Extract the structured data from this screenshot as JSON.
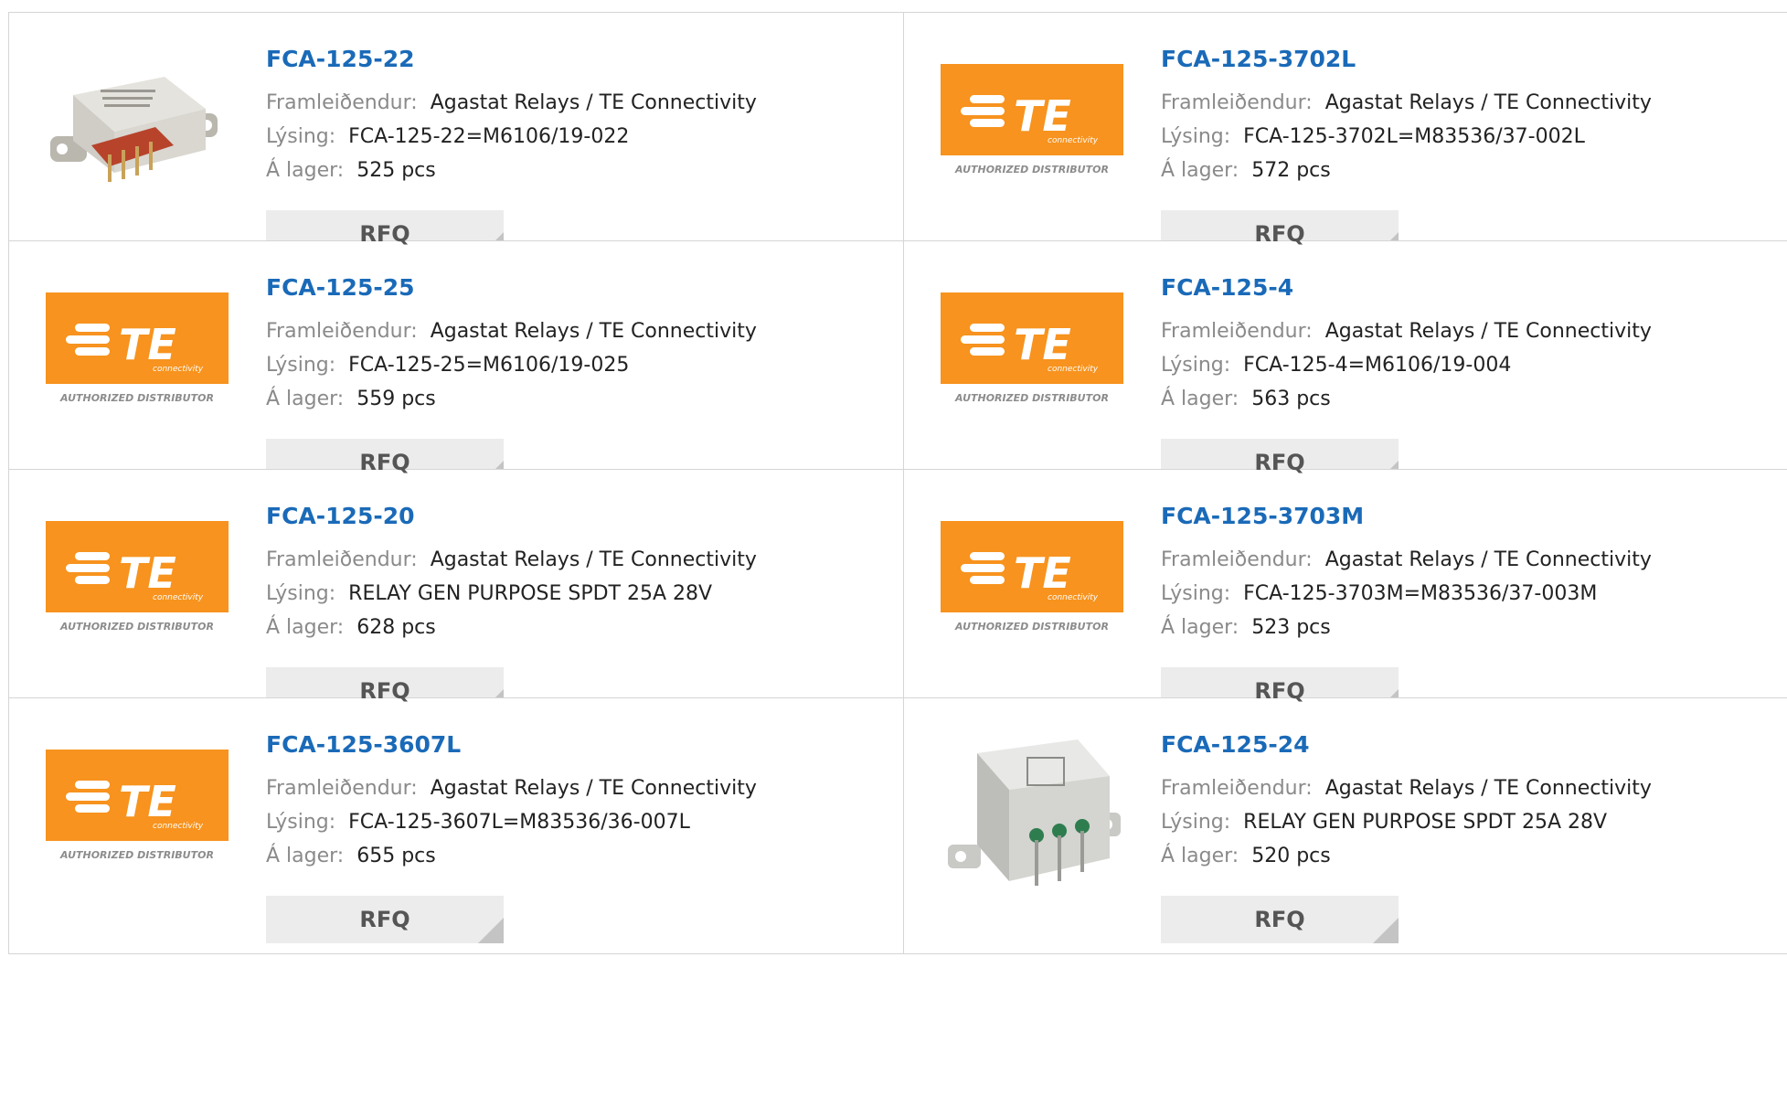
{
  "labels": {
    "manufacturer": "Framleiðendur:",
    "description": "Lýsing:",
    "stock": "Á lager:",
    "rfq": "RFQ"
  },
  "logo": {
    "brand": "TE",
    "tagline": "connectivity",
    "badge": "AUTHORIZED DISTRIBUTOR",
    "color": "#f7931e"
  },
  "colors": {
    "part_link": "#1a6ab8",
    "label": "#8a8a8a",
    "value": "#222222",
    "border": "#d5d5d5",
    "rfq_bg": "#ececec"
  },
  "products": [
    {
      "part": "FCA-125-22",
      "manufacturer": "Agastat Relays / TE Connectivity",
      "description": "FCA-125-22=M6106/19-022",
      "stock": "525 pcs",
      "image": "relay-photo-red-base"
    },
    {
      "part": "FCA-125-3702L",
      "manufacturer": "Agastat Relays / TE Connectivity",
      "description": "FCA-125-3702L=M83536/37-002L",
      "stock": "572 pcs",
      "image": "te-logo"
    },
    {
      "part": "FCA-125-25",
      "manufacturer": "Agastat Relays / TE Connectivity",
      "description": "FCA-125-25=M6106/19-025",
      "stock": "559 pcs",
      "image": "te-logo"
    },
    {
      "part": "FCA-125-4",
      "manufacturer": "Agastat Relays / TE Connectivity",
      "description": "FCA-125-4=M6106/19-004",
      "stock": "563 pcs",
      "image": "te-logo"
    },
    {
      "part": "FCA-125-20",
      "manufacturer": "Agastat Relays / TE Connectivity",
      "description": "RELAY GEN PURPOSE SPDT 25A 28V",
      "stock": "628 pcs",
      "image": "te-logo"
    },
    {
      "part": "FCA-125-3703M",
      "manufacturer": "Agastat Relays / TE Connectivity",
      "description": "FCA-125-3703M=M83536/37-003M",
      "stock": "523 pcs",
      "image": "te-logo"
    },
    {
      "part": "FCA-125-3607L",
      "manufacturer": "Agastat Relays / TE Connectivity",
      "description": "FCA-125-3607L=M83536/36-007L",
      "stock": "655 pcs",
      "image": "te-logo"
    },
    {
      "part": "FCA-125-24",
      "manufacturer": "Agastat Relays / TE Connectivity",
      "description": "RELAY GEN PURPOSE SPDT 25A 28V",
      "stock": "520 pcs",
      "image": "relay-photo-silver"
    }
  ]
}
